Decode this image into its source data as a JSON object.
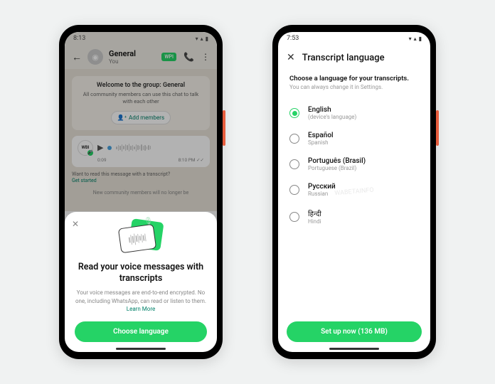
{
  "phone1": {
    "status_time": "8:13",
    "chat": {
      "title": "General",
      "subtitle": "You",
      "badge": "WPI"
    },
    "welcome": {
      "title": "Welcome to the group: General",
      "text": "All community members can use this chat to talk with each other",
      "add_members": "Add members"
    },
    "voice": {
      "avatar": "WBI",
      "duration": "0:09",
      "timestamp": "8:10 PM",
      "prompt_q": "Want to read this message with a transcript?",
      "prompt_link": "Get started"
    },
    "new_members": "New community members will no longer be",
    "sheet": {
      "title": "Read your voice messages with transcripts",
      "desc_pre": "Your voice messages are end-to-end encrypted. No one, including WhatsApp, can read or listen to them. ",
      "desc_link": "Learn More",
      "button": "Choose language"
    }
  },
  "phone2": {
    "status_time": "7:53",
    "title": "Transcript language",
    "heading": "Choose a language for your transcripts.",
    "subheading": "You can always change it in Settings.",
    "languages": [
      {
        "name": "English",
        "sub": "(device's language)",
        "selected": true
      },
      {
        "name": "Español",
        "sub": "Spanish",
        "selected": false
      },
      {
        "name": "Português (Brasil)",
        "sub": "Portuguese (Brazil)",
        "selected": false
      },
      {
        "name": "Русский",
        "sub": "Russian",
        "selected": false
      },
      {
        "name": "हिन्दी",
        "sub": "Hindi",
        "selected": false
      }
    ],
    "button": "Set up now (136 MB)"
  }
}
